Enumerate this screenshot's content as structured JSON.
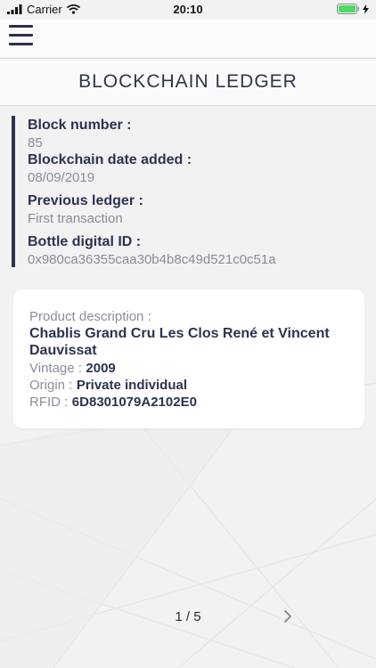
{
  "status_bar": {
    "carrier": "Carrier",
    "time": "20:10"
  },
  "header": {
    "title": "BLOCKCHAIN LEDGER"
  },
  "ledger": {
    "block_number_label": "Block number :",
    "block_number_value": "85",
    "date_added_label": "Blockchain date added :",
    "date_added_value": "08/09/2019",
    "previous_ledger_label": "Previous ledger :",
    "previous_ledger_value": "First transaction",
    "bottle_id_label": "Bottle digital ID :",
    "bottle_id_value": "0x980ca36355caa30b4b8c49d521c0c51a"
  },
  "product": {
    "description_label": "Product description :",
    "name": "Chablis Grand Cru Les Clos René et Vincent Dauvissat",
    "vintage_label": "Vintage :",
    "vintage_value": "2009",
    "origin_label": "Origin :",
    "origin_value": "Private individual",
    "rfid_label": "RFID :",
    "rfid_value": "6D8301079A2102E0"
  },
  "pagination": {
    "text": "1 / 5"
  },
  "colors": {
    "accent": "#2c3350",
    "muted": "#888c98",
    "background": "#f2f2f3"
  },
  "icons": [
    "hamburger-menu-icon",
    "chevron-right-icon",
    "wifi-icon",
    "signal-icon",
    "battery-icon"
  ]
}
